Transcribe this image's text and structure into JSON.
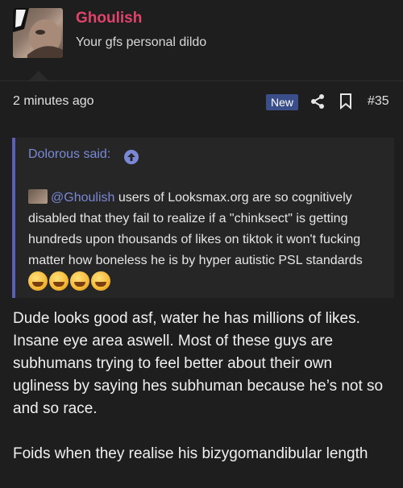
{
  "user": {
    "name": "Ghoulish",
    "title": "Your gfs personal dildo"
  },
  "meta": {
    "time": "2 minutes ago",
    "badge": "New",
    "post_number": "#35"
  },
  "quote": {
    "header": "Dolorous said:",
    "mention": "@Ghoulish",
    "text": " users of Looksmax.org are so cognitively disabled that they fail to realize if a \"chinksect\" is getting hundreds upon thousands of likes on tiktok it won't fucking matter how boneless he is by hyper autistic PSL standards",
    "emoji_icon": "grinning-squint-emoji"
  },
  "post": {
    "paragraph1": "Dude looks good asf, water he has millions of likes. Insane eye area aswell. Most of these guys are subhumans trying to feel better about their own ugliness by saying hes subhuman because he’s not so and so race.",
    "paragraph2": "Foids when they realise his bizygomandibular length"
  },
  "colors": {
    "background": "#1e1e1e",
    "username": "#e0436b",
    "accent": "#7a88d6",
    "badge": "#3a4f8a"
  }
}
